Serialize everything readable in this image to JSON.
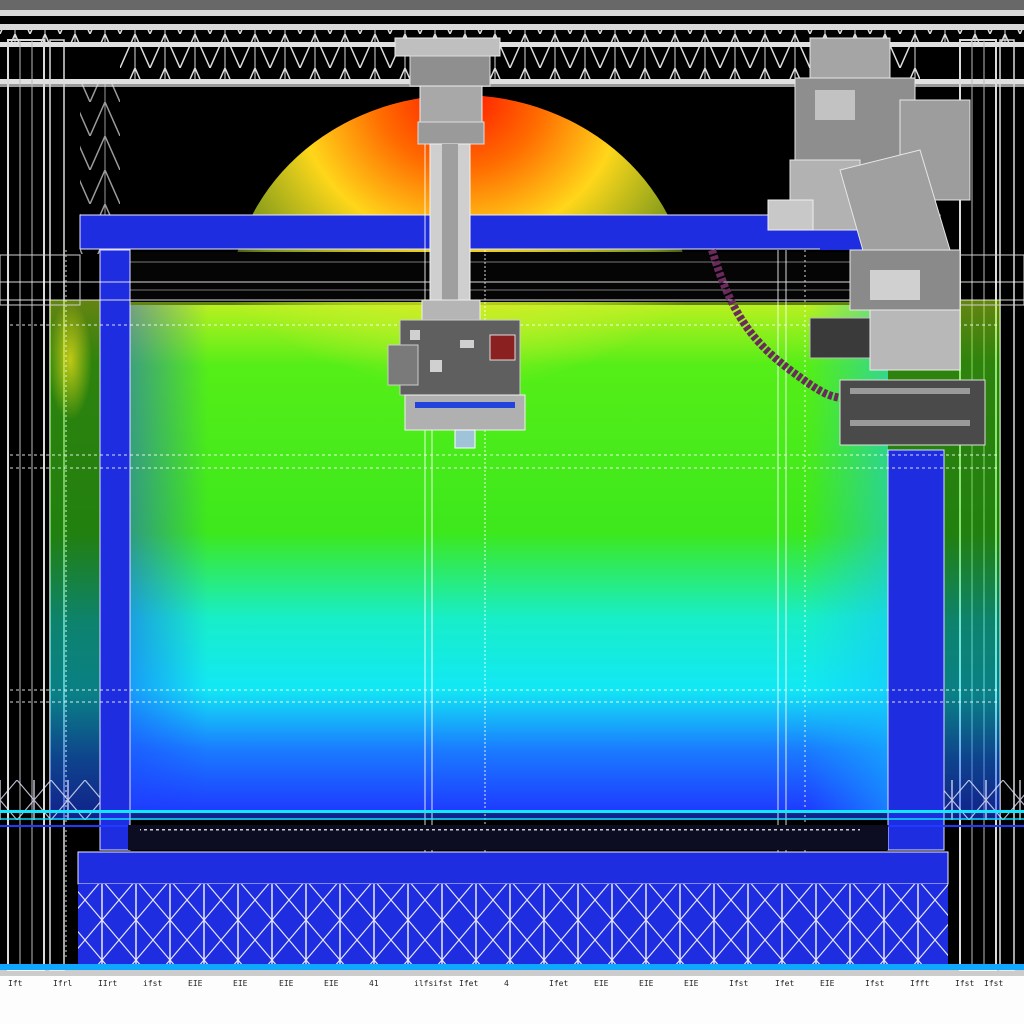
{
  "viewport": {
    "colors": {
      "background": "#000000",
      "structure_blue": "#1f2de0",
      "structure_blue_dark": "#0d1aa8",
      "truss_white": "#e8e8e8",
      "robot_gray": "#a9a9a9",
      "heat_red": "#ff1a00",
      "heat_yellow": "#ffe81a",
      "heat_green": "#3df016",
      "heat_cyan": "#10f0f0",
      "heat_blue": "#1e3dff",
      "cable_purple": "#6a2a5c"
    },
    "icons": [
      "overhead-truss-icon",
      "gantry-spindle-icon",
      "robot-arm-icon",
      "cable-icon",
      "heatmap-icon"
    ]
  },
  "ruler": {
    "labels": [
      "Ift",
      "Ifrl",
      "IIrt",
      "ifst",
      "EIE",
      "EIE",
      "EIE",
      "EIE",
      "41",
      "ilfsifst",
      "Ifet",
      "4",
      "Ifet",
      "EIE",
      "EIE",
      "EIE",
      "Ifst",
      "Ifet",
      "EIE",
      "Ifst",
      "Ifft",
      "Ifst",
      "Ifst"
    ]
  }
}
